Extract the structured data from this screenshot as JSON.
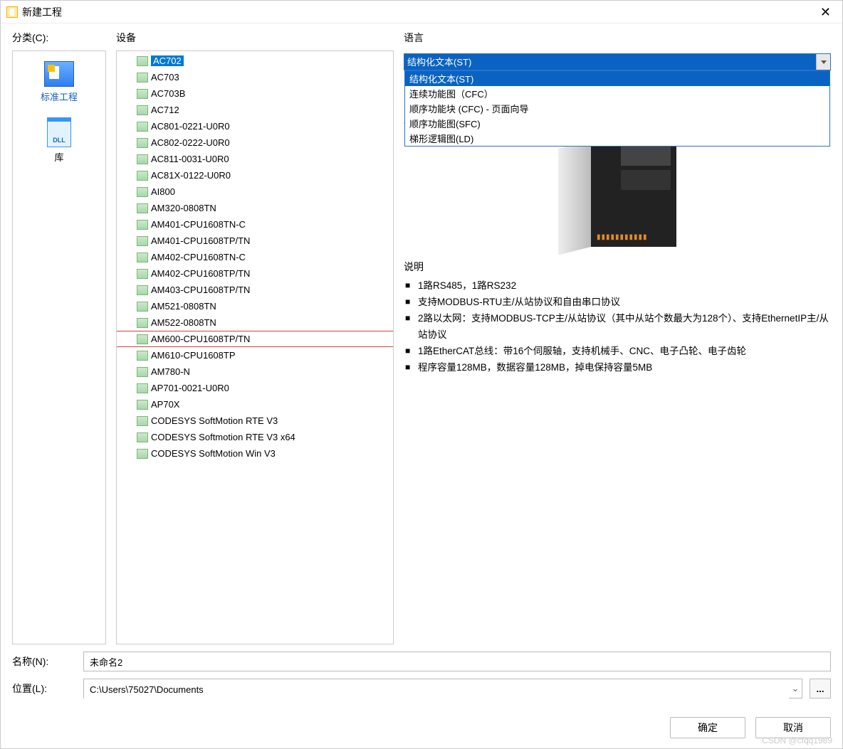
{
  "window": {
    "title": "新建工程"
  },
  "labels": {
    "category": "分类(C):",
    "device": "设备",
    "language": "语言",
    "device_side": "设备",
    "description": "说明",
    "name": "名称(N):",
    "location": "位置(L):"
  },
  "categories": [
    {
      "id": "std",
      "label": "标准工程",
      "selected": true
    },
    {
      "id": "lib",
      "label": "库",
      "selected": false
    }
  ],
  "devices": [
    "AC702",
    "AC703",
    "AC703B",
    "AC712",
    "AC801-0221-U0R0",
    "AC802-0222-U0R0",
    "AC811-0031-U0R0",
    "AC81X-0122-U0R0",
    "AI800",
    "AM320-0808TN",
    "AM401-CPU1608TN-C",
    "AM401-CPU1608TP/TN",
    "AM402-CPU1608TN-C",
    "AM402-CPU1608TP/TN",
    "AM403-CPU1608TP/TN",
    "AM521-0808TN",
    "AM522-0808TN",
    "AM600-CPU1608TP/TN",
    "AM610-CPU1608TP",
    "AM780-N",
    "AP701-0021-U0R0",
    "AP70X",
    "CODESYS SoftMotion RTE V3",
    "CODESYS Softmotion RTE V3 x64",
    "CODESYS SoftMotion Win V3"
  ],
  "device_selected_index": 0,
  "device_marked_index": 17,
  "language": {
    "selected": "结构化文本(ST)",
    "options": [
      "结构化文本(ST)",
      "连续功能图（CFC）",
      "顺序功能块 (CFC) - 页面向导",
      "顺序功能图(SFC)",
      "梯形逻辑图(LD)"
    ]
  },
  "description_lines": [
    "1路RS485，1路RS232",
    "支持MODBUS-RTU主/从站协议和自由串口协议",
    "2路以太网：支持MODBUS-TCP主/从站协议（其中从站个数最大为128个）、支持EthernetIP主/从站协议",
    "1路EtherCAT总线：带16个伺服轴，支持机械手、CNC、电子凸轮、电子齿轮",
    "程序容量128MB，数据容量128MB，掉电保持容量5MB"
  ],
  "form": {
    "name_value": "未命名2",
    "location_value": "C:\\Users\\75027\\Documents"
  },
  "buttons": {
    "ok": "确定",
    "cancel": "取消"
  },
  "watermark": "CSDN @cfqq1989"
}
